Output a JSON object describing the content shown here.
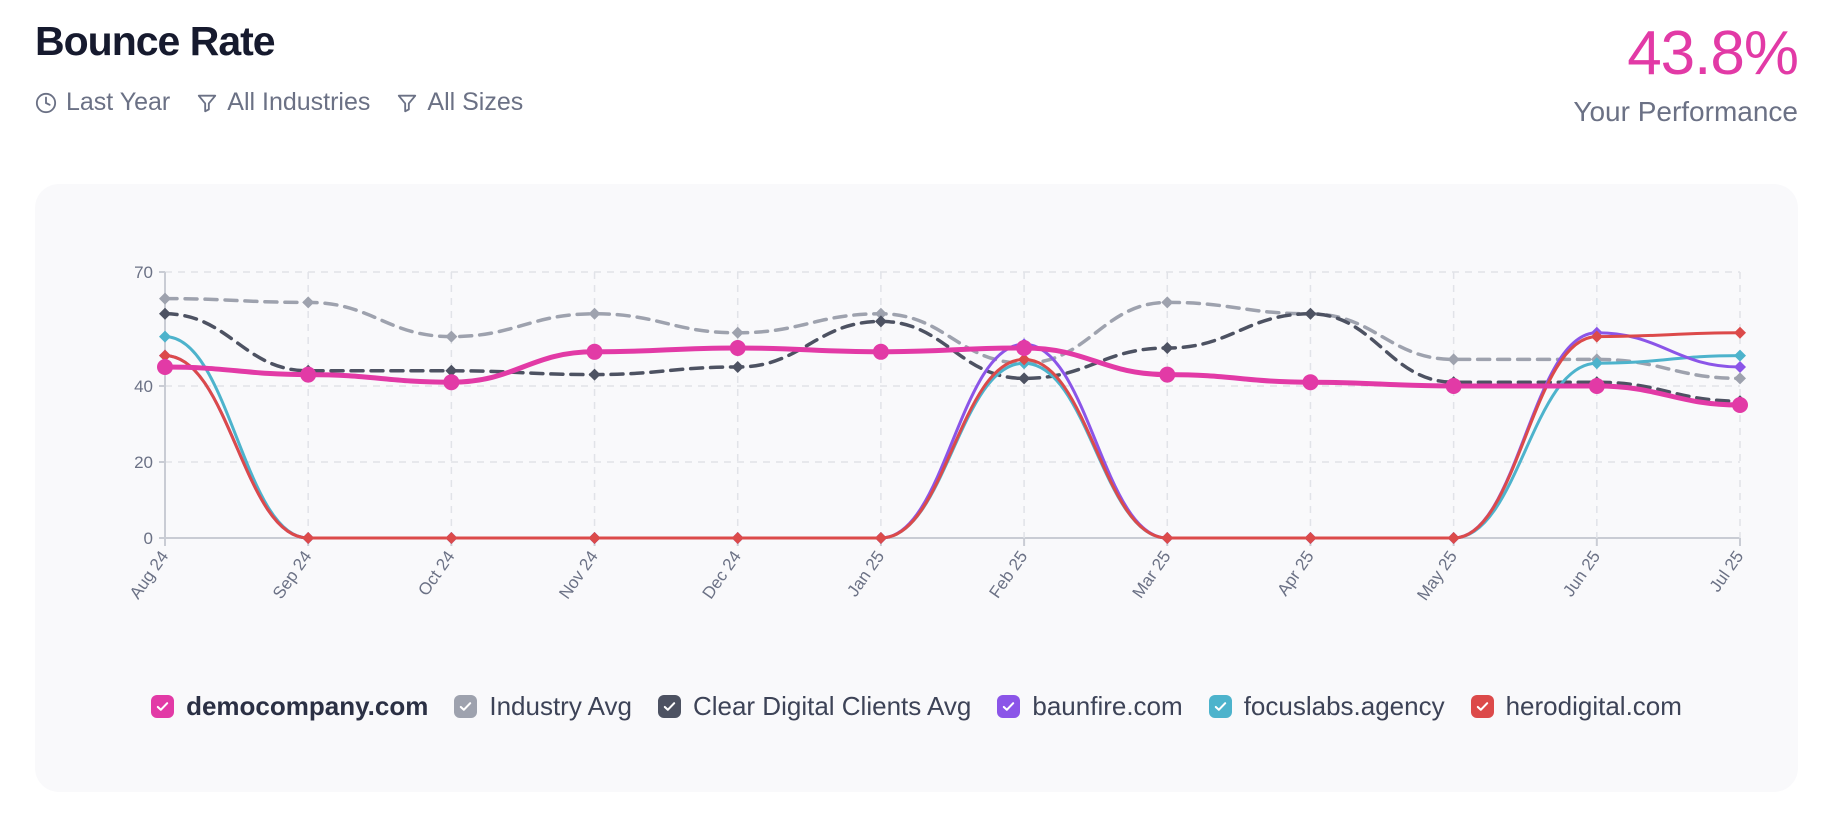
{
  "header": {
    "title": "Bounce Rate",
    "filters": [
      {
        "label": "Last Year",
        "icon": "clock-icon"
      },
      {
        "label": "All Industries",
        "icon": "filter-icon"
      },
      {
        "label": "All Sizes",
        "icon": "filter-icon"
      }
    ],
    "performance_value": "43.8%",
    "performance_label": "Your Performance"
  },
  "chart_data": {
    "type": "line",
    "categories": [
      "Aug 24",
      "Sep 24",
      "Oct 24",
      "Nov 24",
      "Dec 24",
      "Jan 25",
      "Feb 25",
      "Mar 25",
      "Apr 25",
      "May 25",
      "Jun 25",
      "Jul 25"
    ],
    "ylim": [
      0,
      70
    ],
    "yticks": [
      0,
      20,
      40,
      70
    ],
    "grid": true,
    "legend_position": "bottom",
    "series": [
      {
        "name": "democompany.com",
        "color": "#e23aa6",
        "style": "solid",
        "marker": "circle",
        "values": [
          45,
          43,
          41,
          49,
          50,
          49,
          50,
          43,
          41,
          40,
          40,
          35
        ]
      },
      {
        "name": "Industry Avg",
        "color": "#9ea2ae",
        "style": "dashed",
        "marker": "diamond",
        "values": [
          63,
          62,
          53,
          59,
          54,
          59,
          46,
          62,
          59,
          47,
          47,
          42
        ]
      },
      {
        "name": "Clear Digital Clients Avg",
        "color": "#4d5262",
        "style": "dashed",
        "marker": "diamond",
        "values": [
          59,
          44,
          44,
          43,
          45,
          57,
          42,
          50,
          59,
          41,
          41,
          36
        ]
      },
      {
        "name": "baunfire.com",
        "color": "#8b55e8",
        "style": "solid",
        "marker": "diamond",
        "values": [
          48,
          0,
          0,
          0,
          0,
          0,
          51,
          0,
          0,
          0,
          54,
          45
        ]
      },
      {
        "name": "focuslabs.agency",
        "color": "#4db3cc",
        "style": "solid",
        "marker": "diamond",
        "values": [
          53,
          0,
          0,
          0,
          0,
          0,
          46,
          0,
          0,
          0,
          46,
          48
        ]
      },
      {
        "name": "herodigital.com",
        "color": "#dc4a4a",
        "style": "solid",
        "marker": "diamond",
        "values": [
          48,
          0,
          0,
          0,
          0,
          0,
          47,
          0,
          0,
          0,
          53,
          54
        ]
      }
    ]
  }
}
